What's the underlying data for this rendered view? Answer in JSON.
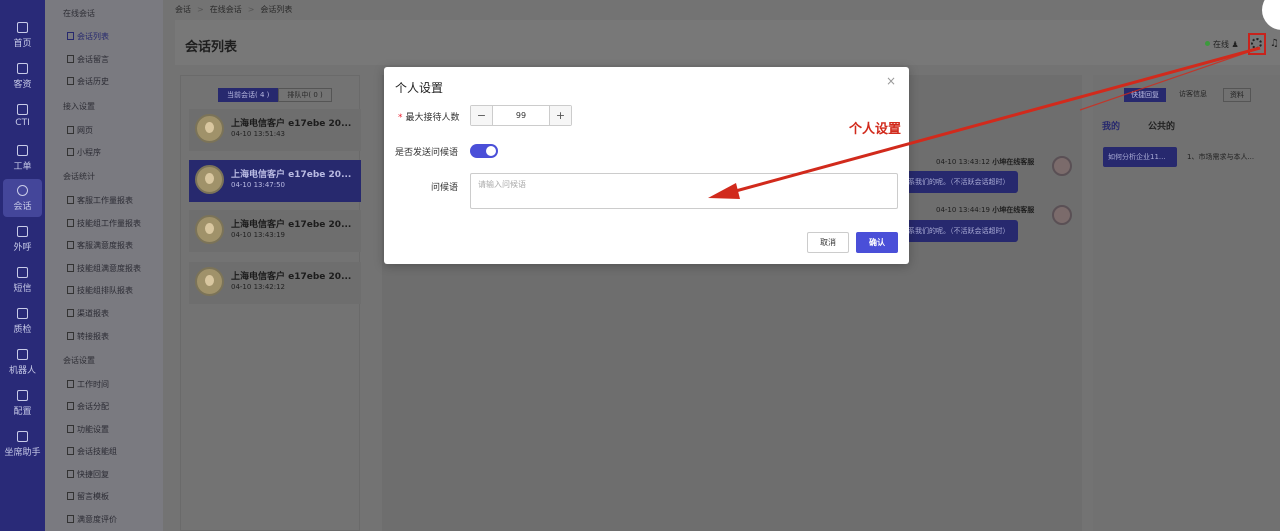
{
  "rail": [
    {
      "icon": "home-icon",
      "label": "首页"
    },
    {
      "icon": "customers-icon",
      "label": "客资"
    },
    {
      "icon": "cti-icon",
      "label": "CTI"
    },
    {
      "icon": "ticket-icon",
      "label": "工单"
    },
    {
      "icon": "chat-icon",
      "label": "会话"
    },
    {
      "icon": "phone-icon",
      "label": "外呼"
    },
    {
      "icon": "sms-icon",
      "label": "短信"
    },
    {
      "icon": "quality-icon",
      "label": "质检"
    },
    {
      "icon": "robot-icon",
      "label": "机器人"
    },
    {
      "icon": "settings-icon",
      "label": "配置"
    },
    {
      "icon": "assistant-icon",
      "label": "坐席助手"
    }
  ],
  "submenu": {
    "groups": [
      "在线会话",
      "接入设置",
      "会话统计",
      "会话设置"
    ],
    "online": [
      "会话列表",
      "会话留言",
      "会话历史"
    ],
    "access": [
      "网页",
      "小程序"
    ],
    "stats": [
      "客服工作量报表",
      "技能组工作量报表",
      "客服满意度报表",
      "技能组满意度报表",
      "技能组排队报表",
      "渠道报表",
      "转接报表"
    ],
    "settings": [
      "工作时间",
      "会话分配",
      "功能设置",
      "会话技能组",
      "快捷回复",
      "留言模板",
      "满意度评价"
    ]
  },
  "breadcrumb": [
    "会话",
    "在线会话",
    "会话列表"
  ],
  "header": {
    "title": "会话列表",
    "status": "在线"
  },
  "tabs": {
    "current": "当前会话( 4 )",
    "queue": "排队中( 0 )"
  },
  "sessions": [
    {
      "name": "上海电信客户 e17ebe 20...",
      "time": "04-10 13:51:43"
    },
    {
      "name": "上海电信客户 e17ebe 20...",
      "time": "04-10 13:47:50"
    },
    {
      "name": "上海电信客户 e17ebe 20...",
      "time": "04-10 13:43:19"
    },
    {
      "name": "上海电信客户 e17ebe 20...",
      "time": "04-10 13:42:12"
    }
  ],
  "chat": [
    {
      "time": "04-10 13:43:12",
      "agent": "小坤在线客服",
      "text": "系我们的呢。（不活跃会话超时）"
    },
    {
      "time": "04-10 13:44:19",
      "agent": "小坤在线客服",
      "text": "系我们的呢。（不活跃会话超时）"
    }
  ],
  "right_panel": {
    "tabs": [
      "快捷回复",
      "访客信息",
      "资料"
    ],
    "subtabs": [
      "我的",
      "公共的"
    ],
    "quick_reply_btn": "如何分析企业11...",
    "quick_reply_text": "1、市场需求与本人..."
  },
  "modal": {
    "title": "个人设置",
    "close": "×",
    "max_label": "最大接待人数",
    "required_mark": "*",
    "max_value": "99",
    "minus": "−",
    "plus": "+",
    "send_greeting_label": "是否发送问候语",
    "greeting_label": "问候语",
    "greeting_placeholder": "请输入问候语",
    "cancel": "取消",
    "confirm": "确认"
  },
  "annotation": {
    "label": "个人设置",
    "color": "#d12a1c"
  }
}
